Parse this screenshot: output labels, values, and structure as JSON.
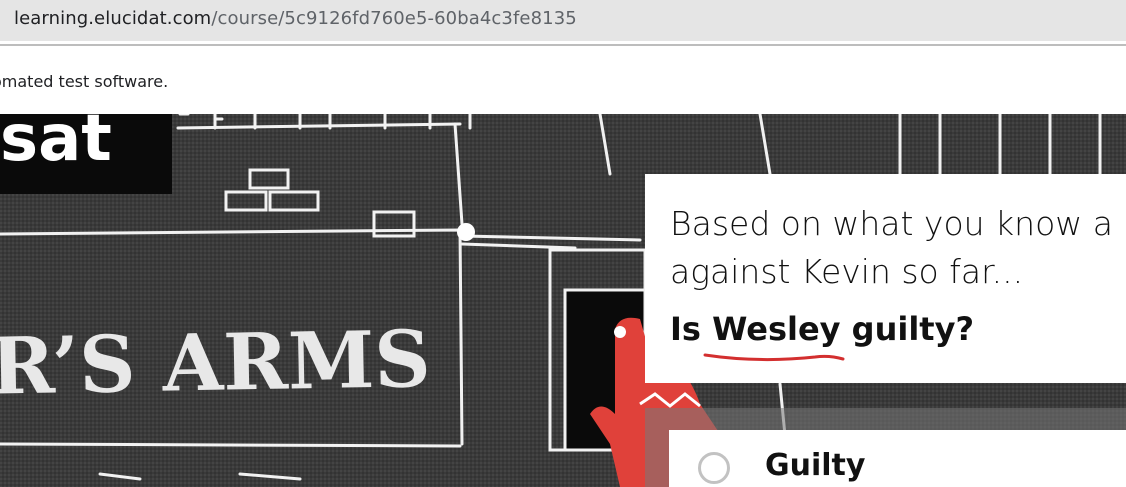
{
  "browser": {
    "url_host": "learning.elucidat.com",
    "url_path": "/course/5c9126fd760e5-60ba4c3fe8135"
  },
  "infobar": {
    "message": "omated test software."
  },
  "scene": {
    "sign_text_top": "sat",
    "sign_text_main": "R’S ARMS"
  },
  "question": {
    "line1": "Based on what you know a",
    "line2": "against Kevin so far...",
    "bold_prefix": "Is ",
    "bold_emphasis": "Wesley",
    "bold_suffix": " guilty?"
  },
  "options": [
    {
      "label": "Guilty",
      "selected": false
    }
  ],
  "colors": {
    "accent_underline": "#d32f2f",
    "figure_red": "#e0413a"
  }
}
